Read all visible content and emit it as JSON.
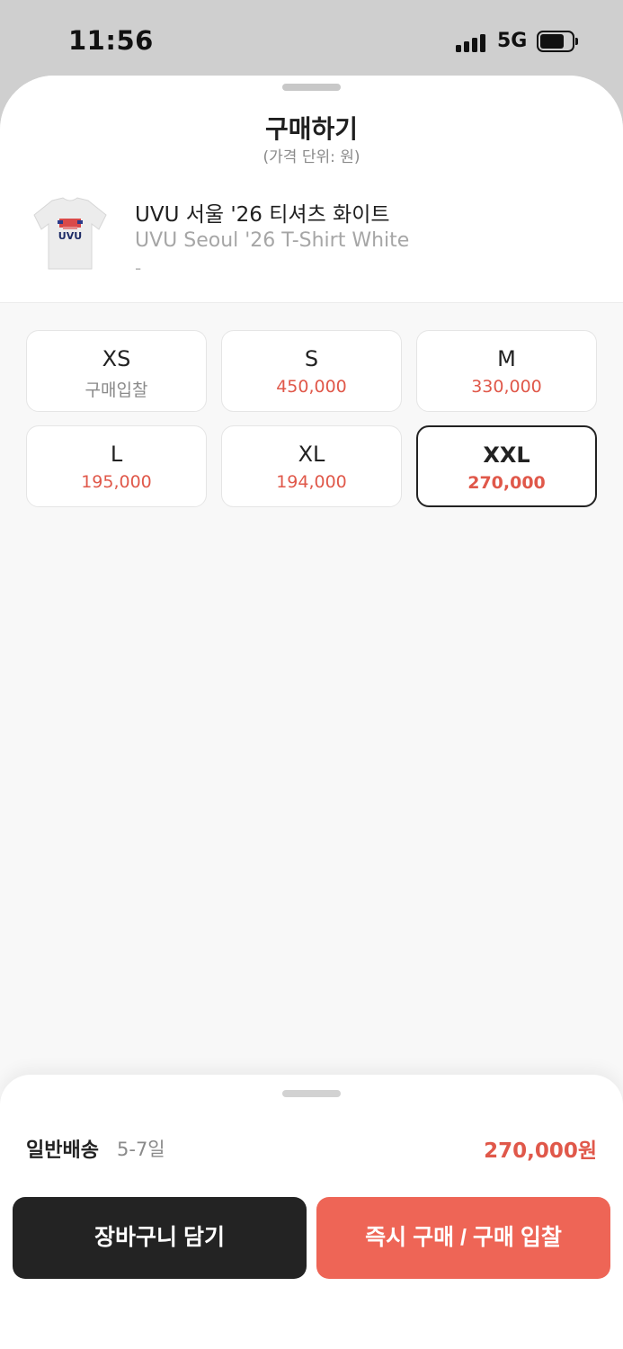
{
  "status_bar": {
    "time": "11:56",
    "network": "5G"
  },
  "sheet": {
    "title": "구매하기",
    "subtitle": "(가격 단위: 원)"
  },
  "product": {
    "name_ko": "UVU 서울 '26 티셔츠 화이트",
    "name_en": "UVU Seoul '26 T-Shirt White",
    "model": "-",
    "thumb_text": "UVU"
  },
  "sizes": [
    {
      "label": "XS",
      "price": "구매입찰",
      "has_price": false,
      "selected": false
    },
    {
      "label": "S",
      "price": "450,000",
      "has_price": true,
      "selected": false
    },
    {
      "label": "M",
      "price": "330,000",
      "has_price": true,
      "selected": false
    },
    {
      "label": "L",
      "price": "195,000",
      "has_price": true,
      "selected": false
    },
    {
      "label": "XL",
      "price": "194,000",
      "has_price": true,
      "selected": false
    },
    {
      "label": "XXL",
      "price": "270,000",
      "has_price": true,
      "selected": true
    }
  ],
  "bottom": {
    "shipping_label": "일반배송",
    "shipping_days": "5-7일",
    "total_price": "270,000원",
    "cart_button": "장바구니 담기",
    "buy_button": "즉시 구매 / 구매 입찰"
  },
  "colors": {
    "accent": "#e0584a",
    "buy_button": "#ee6556",
    "cart_button": "#232323",
    "background": "#f8f8f8"
  },
  "icons": [
    "signal-icon",
    "battery-icon",
    "product-thumbnail"
  ]
}
